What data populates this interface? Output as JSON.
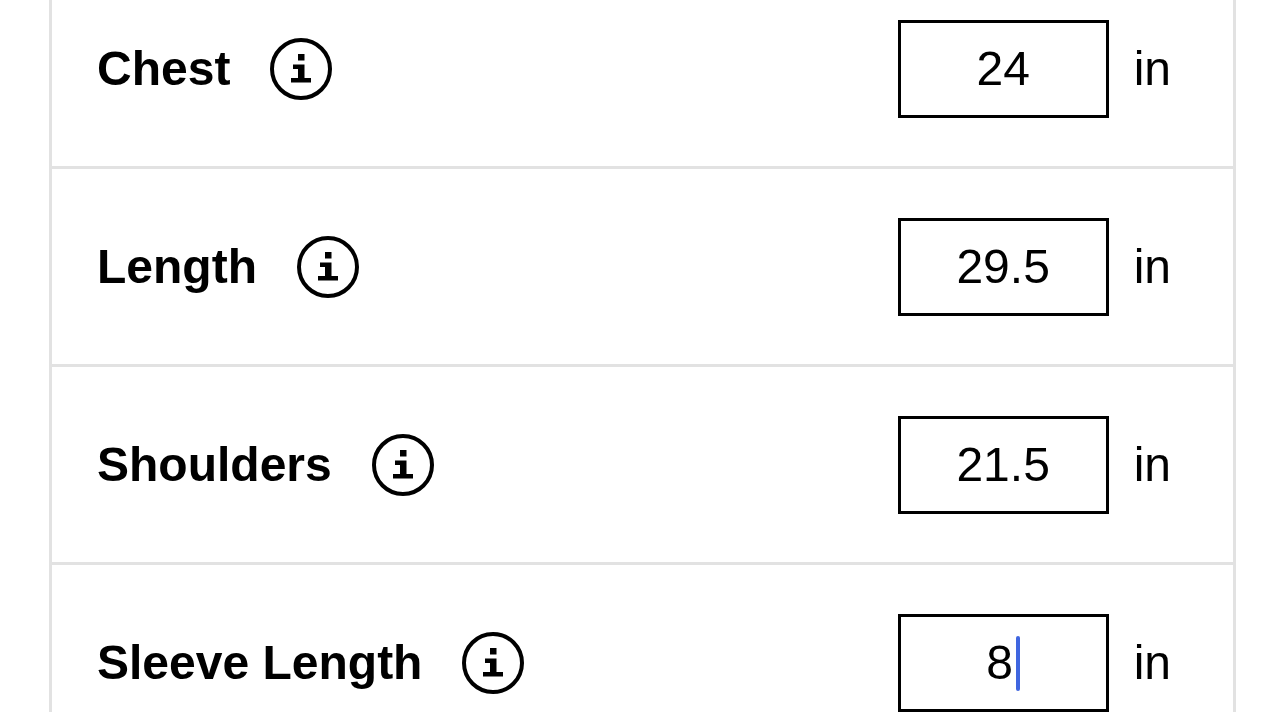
{
  "measurements": [
    {
      "label": "Chest",
      "value": "24",
      "unit": "in",
      "focused": false
    },
    {
      "label": "Length",
      "value": "29.5",
      "unit": "in",
      "focused": false
    },
    {
      "label": "Shoulders",
      "value": "21.5",
      "unit": "in",
      "focused": false
    },
    {
      "label": "Sleeve Length",
      "value": "8",
      "unit": "in",
      "focused": true
    }
  ]
}
